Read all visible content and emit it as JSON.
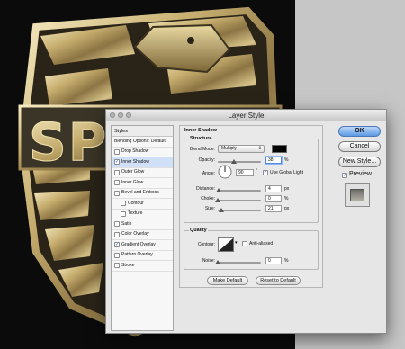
{
  "artwork": {
    "text": "SPOON",
    "icon": "eagle-shield-badge",
    "color": "#c9b47a"
  },
  "dialog": {
    "title": "Layer Style",
    "styles_list": {
      "header": "Styles",
      "items": [
        {
          "label": "Blending Options: Default",
          "checkbox": false,
          "checked": false,
          "selected": false,
          "sub": false
        },
        {
          "label": "Drop Shadow",
          "checkbox": true,
          "checked": false,
          "selected": false,
          "sub": false
        },
        {
          "label": "Inner Shadow",
          "checkbox": true,
          "checked": true,
          "selected": true,
          "sub": false
        },
        {
          "label": "Outer Glow",
          "checkbox": true,
          "checked": false,
          "selected": false,
          "sub": false
        },
        {
          "label": "Inner Glow",
          "checkbox": true,
          "checked": false,
          "selected": false,
          "sub": false
        },
        {
          "label": "Bevel and Emboss",
          "checkbox": true,
          "checked": false,
          "selected": false,
          "sub": false
        },
        {
          "label": "Contour",
          "checkbox": true,
          "checked": false,
          "selected": false,
          "sub": true
        },
        {
          "label": "Texture",
          "checkbox": true,
          "checked": false,
          "selected": false,
          "sub": true
        },
        {
          "label": "Satin",
          "checkbox": true,
          "checked": false,
          "selected": false,
          "sub": false
        },
        {
          "label": "Color Overlay",
          "checkbox": true,
          "checked": false,
          "selected": false,
          "sub": false
        },
        {
          "label": "Gradient Overlay",
          "checkbox": true,
          "checked": true,
          "selected": false,
          "sub": false
        },
        {
          "label": "Pattern Overlay",
          "checkbox": true,
          "checked": false,
          "selected": false,
          "sub": false
        },
        {
          "label": "Stroke",
          "checkbox": true,
          "checked": false,
          "selected": false,
          "sub": false
        }
      ]
    },
    "panel": {
      "title": "Inner Shadow",
      "structure": {
        "label": "Structure",
        "blend_mode_label": "Blend Mode:",
        "blend_mode_value": "Multiply",
        "blend_color": "#000000",
        "opacity_label": "Opacity:",
        "opacity_value": "38",
        "opacity_unit": "%",
        "opacity_fraction": 0.38,
        "angle_label": "Angle:",
        "angle_value": "90",
        "angle_unit": "°",
        "global_light_label": "Use Global Light",
        "global_light_checked": true,
        "distance_label": "Distance:",
        "distance_value": "4",
        "distance_unit": "px",
        "distance_fraction": 0.02,
        "choke_label": "Choke:",
        "choke_value": "0",
        "choke_unit": "%",
        "choke_fraction": 0.0,
        "size_label": "Size:",
        "size_value": "21",
        "size_unit": "px",
        "size_fraction": 0.08
      },
      "quality": {
        "label": "Quality",
        "contour_label": "Contour:",
        "anti_aliased_label": "Anti-aliased",
        "anti_aliased_checked": false,
        "noise_label": "Noise:",
        "noise_value": "0",
        "noise_unit": "%",
        "noise_fraction": 0.0
      },
      "make_default_label": "Make Default",
      "reset_default_label": "Reset to Default"
    },
    "buttons": {
      "ok": "OK",
      "cancel": "Cancel",
      "new_style": "New Style...",
      "preview_label": "Preview",
      "preview_checked": true
    }
  }
}
